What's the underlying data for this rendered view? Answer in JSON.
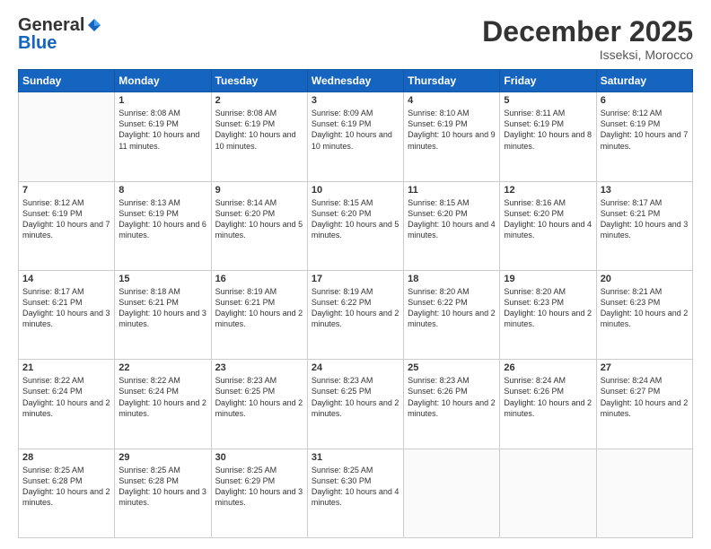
{
  "logo": {
    "general": "General",
    "blue": "Blue"
  },
  "header": {
    "month": "December 2025",
    "location": "Isseksi, Morocco"
  },
  "weekdays": [
    "Sunday",
    "Monday",
    "Tuesday",
    "Wednesday",
    "Thursday",
    "Friday",
    "Saturday"
  ],
  "weeks": [
    [
      {
        "day": "",
        "sunrise": "",
        "sunset": "",
        "daylight": ""
      },
      {
        "day": "1",
        "sunrise": "Sunrise: 8:08 AM",
        "sunset": "Sunset: 6:19 PM",
        "daylight": "Daylight: 10 hours and 11 minutes."
      },
      {
        "day": "2",
        "sunrise": "Sunrise: 8:08 AM",
        "sunset": "Sunset: 6:19 PM",
        "daylight": "Daylight: 10 hours and 10 minutes."
      },
      {
        "day": "3",
        "sunrise": "Sunrise: 8:09 AM",
        "sunset": "Sunset: 6:19 PM",
        "daylight": "Daylight: 10 hours and 10 minutes."
      },
      {
        "day": "4",
        "sunrise": "Sunrise: 8:10 AM",
        "sunset": "Sunset: 6:19 PM",
        "daylight": "Daylight: 10 hours and 9 minutes."
      },
      {
        "day": "5",
        "sunrise": "Sunrise: 8:11 AM",
        "sunset": "Sunset: 6:19 PM",
        "daylight": "Daylight: 10 hours and 8 minutes."
      },
      {
        "day": "6",
        "sunrise": "Sunrise: 8:12 AM",
        "sunset": "Sunset: 6:19 PM",
        "daylight": "Daylight: 10 hours and 7 minutes."
      }
    ],
    [
      {
        "day": "7",
        "sunrise": "Sunrise: 8:12 AM",
        "sunset": "Sunset: 6:19 PM",
        "daylight": "Daylight: 10 hours and 7 minutes."
      },
      {
        "day": "8",
        "sunrise": "Sunrise: 8:13 AM",
        "sunset": "Sunset: 6:19 PM",
        "daylight": "Daylight: 10 hours and 6 minutes."
      },
      {
        "day": "9",
        "sunrise": "Sunrise: 8:14 AM",
        "sunset": "Sunset: 6:20 PM",
        "daylight": "Daylight: 10 hours and 5 minutes."
      },
      {
        "day": "10",
        "sunrise": "Sunrise: 8:15 AM",
        "sunset": "Sunset: 6:20 PM",
        "daylight": "Daylight: 10 hours and 5 minutes."
      },
      {
        "day": "11",
        "sunrise": "Sunrise: 8:15 AM",
        "sunset": "Sunset: 6:20 PM",
        "daylight": "Daylight: 10 hours and 4 minutes."
      },
      {
        "day": "12",
        "sunrise": "Sunrise: 8:16 AM",
        "sunset": "Sunset: 6:20 PM",
        "daylight": "Daylight: 10 hours and 4 minutes."
      },
      {
        "day": "13",
        "sunrise": "Sunrise: 8:17 AM",
        "sunset": "Sunset: 6:21 PM",
        "daylight": "Daylight: 10 hours and 3 minutes."
      }
    ],
    [
      {
        "day": "14",
        "sunrise": "Sunrise: 8:17 AM",
        "sunset": "Sunset: 6:21 PM",
        "daylight": "Daylight: 10 hours and 3 minutes."
      },
      {
        "day": "15",
        "sunrise": "Sunrise: 8:18 AM",
        "sunset": "Sunset: 6:21 PM",
        "daylight": "Daylight: 10 hours and 3 minutes."
      },
      {
        "day": "16",
        "sunrise": "Sunrise: 8:19 AM",
        "sunset": "Sunset: 6:21 PM",
        "daylight": "Daylight: 10 hours and 2 minutes."
      },
      {
        "day": "17",
        "sunrise": "Sunrise: 8:19 AM",
        "sunset": "Sunset: 6:22 PM",
        "daylight": "Daylight: 10 hours and 2 minutes."
      },
      {
        "day": "18",
        "sunrise": "Sunrise: 8:20 AM",
        "sunset": "Sunset: 6:22 PM",
        "daylight": "Daylight: 10 hours and 2 minutes."
      },
      {
        "day": "19",
        "sunrise": "Sunrise: 8:20 AM",
        "sunset": "Sunset: 6:23 PM",
        "daylight": "Daylight: 10 hours and 2 minutes."
      },
      {
        "day": "20",
        "sunrise": "Sunrise: 8:21 AM",
        "sunset": "Sunset: 6:23 PM",
        "daylight": "Daylight: 10 hours and 2 minutes."
      }
    ],
    [
      {
        "day": "21",
        "sunrise": "Sunrise: 8:22 AM",
        "sunset": "Sunset: 6:24 PM",
        "daylight": "Daylight: 10 hours and 2 minutes."
      },
      {
        "day": "22",
        "sunrise": "Sunrise: 8:22 AM",
        "sunset": "Sunset: 6:24 PM",
        "daylight": "Daylight: 10 hours and 2 minutes."
      },
      {
        "day": "23",
        "sunrise": "Sunrise: 8:23 AM",
        "sunset": "Sunset: 6:25 PM",
        "daylight": "Daylight: 10 hours and 2 minutes."
      },
      {
        "day": "24",
        "sunrise": "Sunrise: 8:23 AM",
        "sunset": "Sunset: 6:25 PM",
        "daylight": "Daylight: 10 hours and 2 minutes."
      },
      {
        "day": "25",
        "sunrise": "Sunrise: 8:23 AM",
        "sunset": "Sunset: 6:26 PM",
        "daylight": "Daylight: 10 hours and 2 minutes."
      },
      {
        "day": "26",
        "sunrise": "Sunrise: 8:24 AM",
        "sunset": "Sunset: 6:26 PM",
        "daylight": "Daylight: 10 hours and 2 minutes."
      },
      {
        "day": "27",
        "sunrise": "Sunrise: 8:24 AM",
        "sunset": "Sunset: 6:27 PM",
        "daylight": "Daylight: 10 hours and 2 minutes."
      }
    ],
    [
      {
        "day": "28",
        "sunrise": "Sunrise: 8:25 AM",
        "sunset": "Sunset: 6:28 PM",
        "daylight": "Daylight: 10 hours and 2 minutes."
      },
      {
        "day": "29",
        "sunrise": "Sunrise: 8:25 AM",
        "sunset": "Sunset: 6:28 PM",
        "daylight": "Daylight: 10 hours and 3 minutes."
      },
      {
        "day": "30",
        "sunrise": "Sunrise: 8:25 AM",
        "sunset": "Sunset: 6:29 PM",
        "daylight": "Daylight: 10 hours and 3 minutes."
      },
      {
        "day": "31",
        "sunrise": "Sunrise: 8:25 AM",
        "sunset": "Sunset: 6:30 PM",
        "daylight": "Daylight: 10 hours and 4 minutes."
      },
      {
        "day": "",
        "sunrise": "",
        "sunset": "",
        "daylight": ""
      },
      {
        "day": "",
        "sunrise": "",
        "sunset": "",
        "daylight": ""
      },
      {
        "day": "",
        "sunrise": "",
        "sunset": "",
        "daylight": ""
      }
    ]
  ]
}
